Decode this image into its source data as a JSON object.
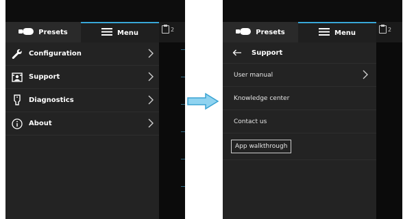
{
  "left_panel": {
    "tabs": {
      "presets_label": "Presets",
      "menu_label": "Menu"
    },
    "badge_count": "2",
    "menu_items": [
      {
        "label": "Configuration",
        "icon": "wrench-icon"
      },
      {
        "label": "Support",
        "icon": "support-icon"
      },
      {
        "label": "Diagnostics",
        "icon": "diagnostics-icon"
      },
      {
        "label": "About",
        "icon": "info-icon"
      }
    ]
  },
  "right_panel": {
    "tabs": {
      "presets_label": "Presets",
      "menu_label": "Menu"
    },
    "badge_count": "2",
    "header_title": "Support",
    "items": [
      {
        "label": "User manual",
        "has_chevron": true
      },
      {
        "label": "Knowledge center",
        "has_chevron": false
      },
      {
        "label": "Contact us",
        "has_chevron": false
      }
    ],
    "walkthrough_label": "App walkthrough"
  },
  "colors": {
    "accent": "#39a7d8",
    "arrow": "#5bbde8",
    "panel_bg": "#1a1a1a",
    "list_bg": "#232323"
  }
}
